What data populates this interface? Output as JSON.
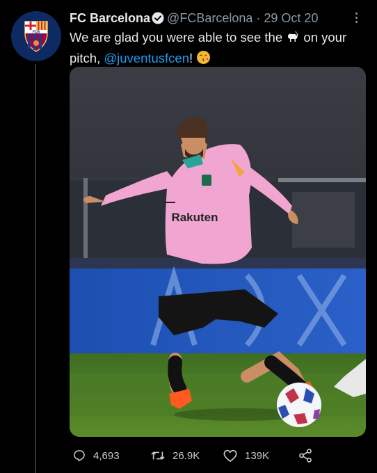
{
  "tweet": {
    "author_name": "FC Barcelona",
    "handle": "@FCBarcelona",
    "separator": "·",
    "date": "29 Oct 20",
    "text_part1": "We are glad you were able to see the",
    "goat_emoji": "🐐",
    "text_part2": "on your pitch,",
    "mention": "@juventusfcen",
    "text_part3": "!",
    "kiss_emoji": "😘",
    "avatar_letters": "FCB",
    "media": {
      "sponsor": "Rakuten"
    }
  },
  "actions": {
    "replies": "4,693",
    "retweets": "26.9K",
    "likes": "139K"
  },
  "colors": {
    "background": "#000000",
    "link": "#1d9bf0",
    "secondary_text": "#8b98a5",
    "jersey_pink": "#f0a6d0"
  }
}
